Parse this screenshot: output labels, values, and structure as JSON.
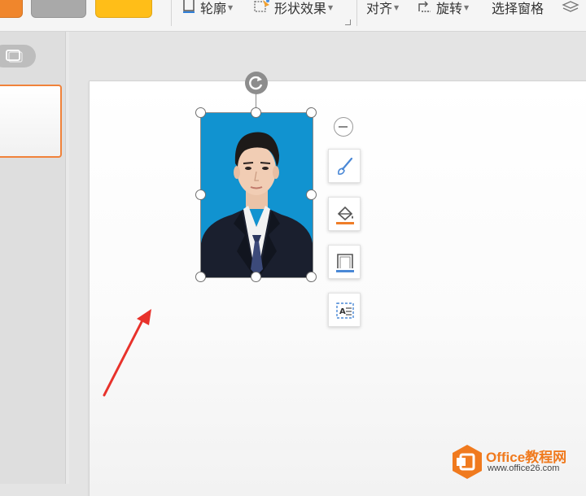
{
  "ribbon": {
    "outline_label": "轮廓",
    "shape_effect_label": "形状效果",
    "align_label": "对齐",
    "rotate_label": "旋转",
    "selection_pane_label": "选择窗格",
    "swatches": [
      "#f0862c",
      "#a9a9a9",
      "#ffbe18"
    ]
  },
  "left_panel": {
    "view_toggle_icon": "slide-view-icon",
    "selected_thumb_color": "#f0823a"
  },
  "slide": {
    "photo": {
      "background_color": "#1193d0",
      "description_icon": "id-photo"
    },
    "float_tools": [
      "collapse-icon",
      "brush-icon",
      "fill-icon",
      "outline-icon",
      "text-layout-icon"
    ],
    "annotation_color": "#e8322b"
  },
  "watermark": {
    "title": "Office教程网",
    "url": "www.office26.com"
  }
}
